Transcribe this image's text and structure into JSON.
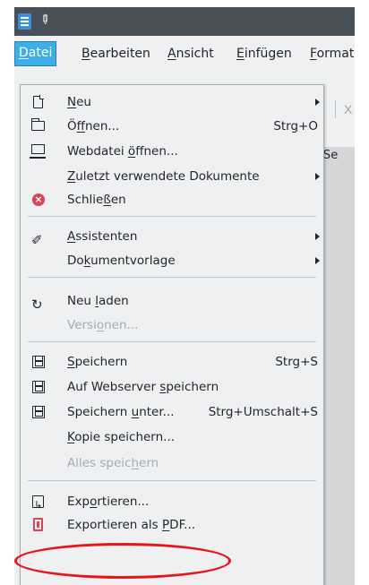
{
  "menubar": {
    "items": [
      {
        "label": "Datei",
        "u": "D",
        "rest": "atei"
      },
      {
        "label": "Bearbeiten",
        "u": "B",
        "rest": "earbeiten"
      },
      {
        "label": "Ansicht",
        "u": "A",
        "rest": "nsicht"
      },
      {
        "label": "Einfügen",
        "u": "E",
        "rest": "infügen"
      },
      {
        "label": "Format",
        "u": "F",
        "rest": "ormat"
      }
    ]
  },
  "background": {
    "doc_text": "ion Se",
    "toolbar_glyph": "X"
  },
  "menu": {
    "items": [
      {
        "label": "Neu",
        "pre": "",
        "u": "N",
        "post": "eu",
        "icon": "new-document-icon"
      },
      {
        "label": "Öffnen...",
        "pre": "Ö",
        "u": "f",
        "post": "fnen...",
        "shortcut": "Strg+O",
        "icon": "folder-open-icon"
      },
      {
        "label": "Webdatei öffnen...",
        "pre": "Webdatei ",
        "u": "ö",
        "post": "ffnen...",
        "icon": "web-file-icon"
      },
      {
        "label": "Zuletzt verwendete Dokumente",
        "pre": "",
        "u": "Z",
        "post": "uletzt verwendete Dokumente"
      },
      {
        "label": "Schließen",
        "pre": "Schlie",
        "u": "ß",
        "post": "en",
        "icon": "close-icon"
      },
      {
        "label": "Assistenten",
        "pre": "",
        "u": "A",
        "post": "ssistenten",
        "icon": "wizard-icon"
      },
      {
        "label": "Dokumentvorlage",
        "pre": "Do",
        "u": "k",
        "post": "umentvorlage"
      },
      {
        "label": "Neu laden",
        "pre": "Neu ",
        "u": "l",
        "post": "aden",
        "icon": "reload-icon"
      },
      {
        "label": "Versionen...",
        "pre": "Versi",
        "u": "o",
        "post": "nen..."
      },
      {
        "label": "Speichern",
        "pre": "",
        "u": "S",
        "post": "peichern",
        "shortcut": "Strg+S",
        "icon": "save-icon"
      },
      {
        "label": "Auf Webserver speichern",
        "pre": "Auf Webserver ",
        "u": "s",
        "post": "peichern",
        "icon": "save-remote-icon"
      },
      {
        "label": "Speichern unter...",
        "pre": "Speichern ",
        "u": "u",
        "post": "nter...",
        "shortcut": "Strg+Umschalt+S",
        "icon": "save-as-icon"
      },
      {
        "label": "Kopie speichern...",
        "pre": "",
        "u": "K",
        "post": "opie speichern..."
      },
      {
        "label": "Alles speichern",
        "pre": "Alles speic",
        "u": "h",
        "post": "ern"
      },
      {
        "label": "Exportieren...",
        "pre": "Exp",
        "u": "o",
        "post": "rtieren...",
        "icon": "export-icon"
      },
      {
        "label": "Exportieren als PDF...",
        "pre": "Exportieren als ",
        "u": "P",
        "post": "DF...",
        "icon": "export-pdf-icon"
      }
    ]
  },
  "colors": {
    "titlebar": "#475057",
    "menu_highlight": "#3daee9",
    "annotation": "#e8141b"
  }
}
